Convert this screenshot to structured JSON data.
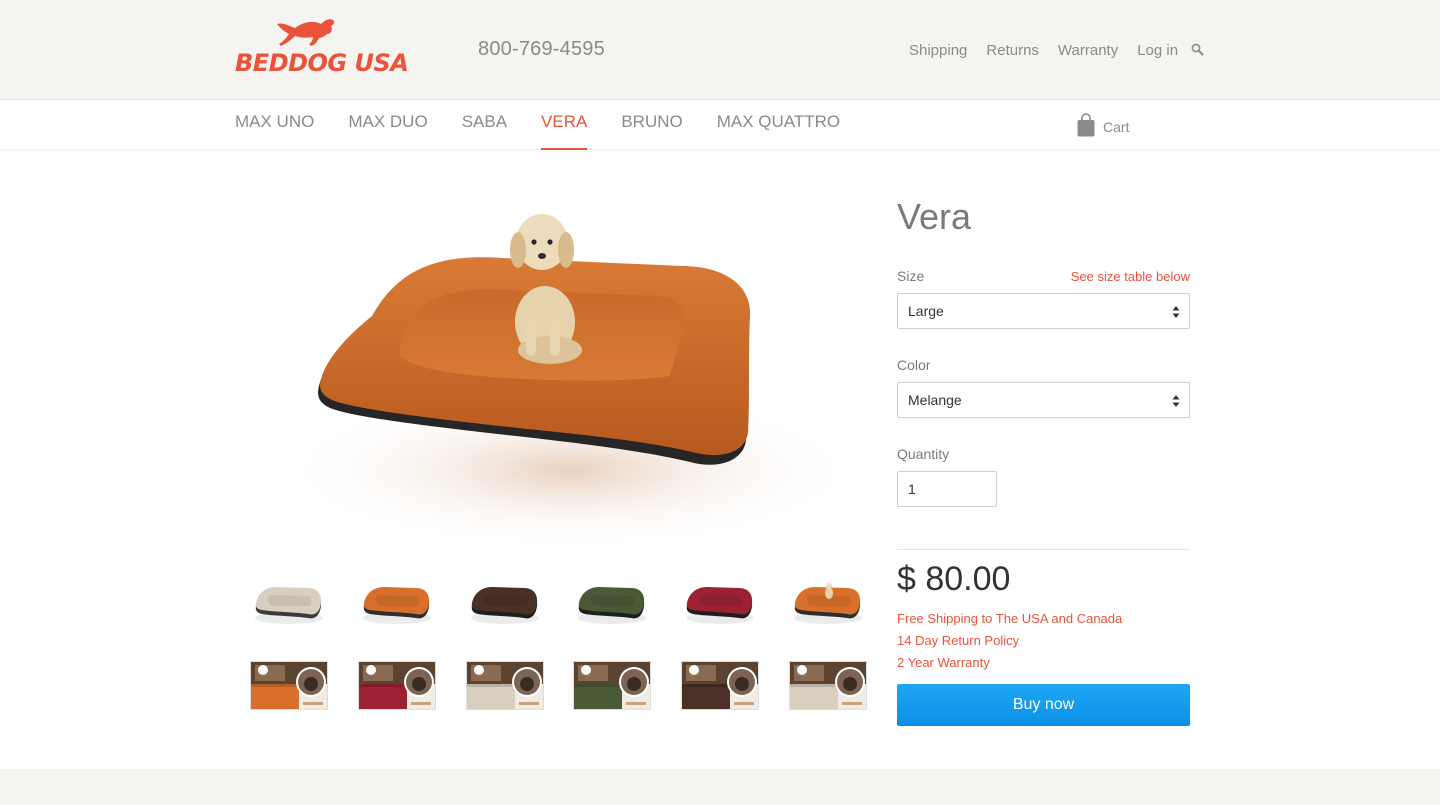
{
  "brand": {
    "logo_text": "BEDDOG USA",
    "phone": "800-769-4595",
    "accent": "#e8533a"
  },
  "util_nav": [
    "Shipping",
    "Returns",
    "Warranty",
    "Log in"
  ],
  "main_nav": {
    "items": [
      {
        "label": "MAX UNO",
        "active": false
      },
      {
        "label": "MAX DUO",
        "active": false
      },
      {
        "label": "SABA",
        "active": false
      },
      {
        "label": "VERA",
        "active": true
      },
      {
        "label": "BRUNO",
        "active": false
      },
      {
        "label": "MAX QUATTRO",
        "active": false
      }
    ],
    "cart_label": "Cart"
  },
  "gallery": {
    "hero": "orange dog bed with puppy",
    "bed_thumbs": [
      {
        "color": "#d9cfc0",
        "edge": "#3a3a3a"
      },
      {
        "color": "#d8702b",
        "edge": "#2e2e2e"
      },
      {
        "color": "#4a3026",
        "edge": "#1e1e1e"
      },
      {
        "color": "#4a5a36",
        "edge": "#1e1e1e"
      },
      {
        "color": "#9c2233",
        "edge": "#1e1e1e"
      },
      {
        "color": "#d8702b",
        "edge": "#2e2e2e"
      }
    ],
    "photo_thumbs": [
      {
        "bed": "#d8702b"
      },
      {
        "bed": "#9c2233"
      },
      {
        "bed": "#d9cfc0"
      },
      {
        "bed": "#4a5a36"
      },
      {
        "bed": "#4a3026"
      },
      {
        "bed": "#d9cfc0"
      }
    ]
  },
  "product": {
    "title": "Vera",
    "size_label": "Size",
    "size_link": "See size table below",
    "size_value": "Large",
    "color_label": "Color",
    "color_value": "Melange",
    "quantity_label": "Quantity",
    "quantity_value": "1",
    "price": "$ 80.00",
    "perks": [
      "Free Shipping to The USA and Canada",
      "14 Day Return Policy",
      "2 Year Warranty"
    ],
    "buy_label": "Buy now"
  }
}
